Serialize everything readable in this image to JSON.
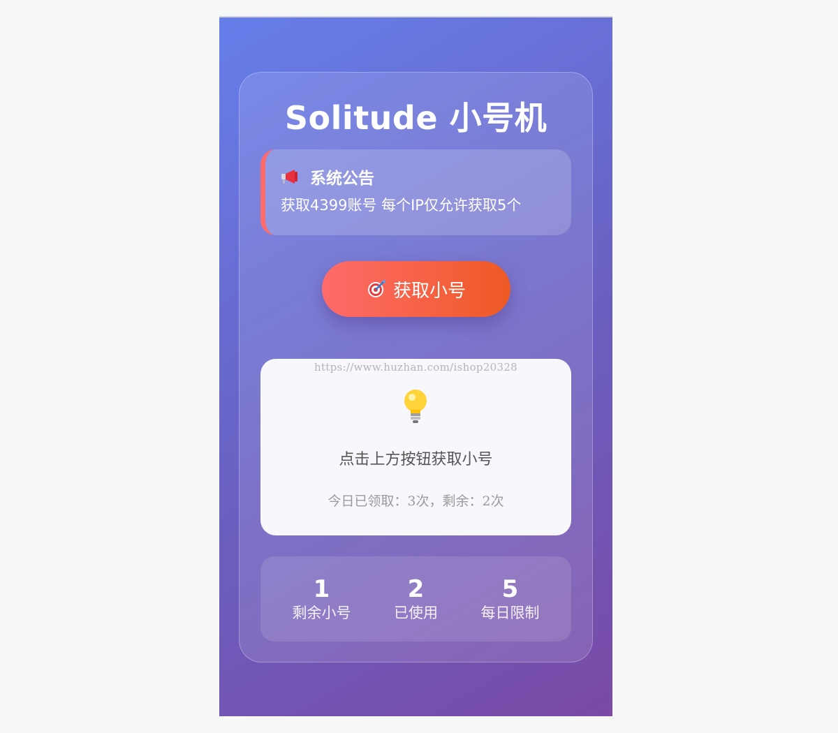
{
  "app": {
    "title": "Solitude 小号机"
  },
  "notice": {
    "icon": "megaphone-icon",
    "title": "系统公告",
    "text": "获取4399账号 每个IP仅允许获取5个"
  },
  "get_button": {
    "icon": "target-icon",
    "label": "获取小号"
  },
  "result": {
    "watermark": "https://www.huzhan.com/ishop20328",
    "icon": "lightbulb-icon",
    "hint": "点击上方按钮获取小号",
    "counts": "今日已领取：3次，剩余：2次"
  },
  "stats": [
    {
      "value": "1",
      "label": "剩余小号"
    },
    {
      "value": "2",
      "label": "已使用"
    },
    {
      "value": "5",
      "label": "每日限制"
    }
  ],
  "colors": {
    "accent_start": "#ff6b6b",
    "accent_end": "#ee5a24",
    "bg_start": "#667eea",
    "bg_end": "#764ba2"
  }
}
